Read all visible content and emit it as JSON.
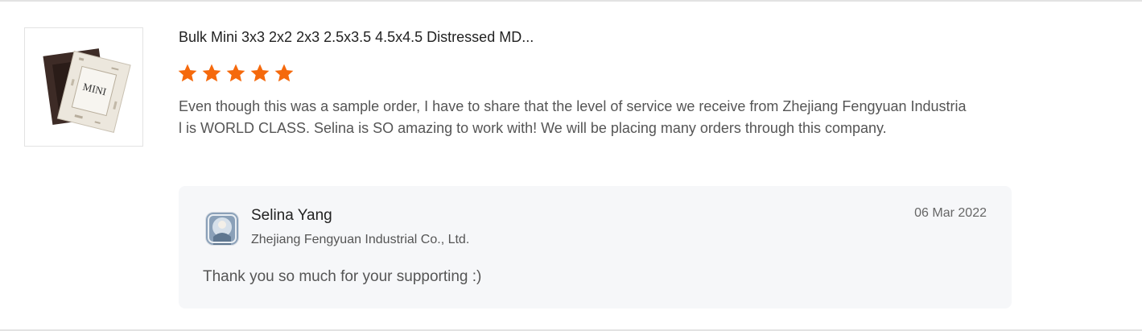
{
  "review": {
    "product_title": "Bulk Mini 3x3 2x2 2x3 2.5x3.5 4.5x4.5 Distressed MD...",
    "rating": 5,
    "rating_max": 5,
    "star_color": "#f5690c",
    "text": "Even though this was a sample order, I have to share that the level of service we receive from Zhejiang Fengyuan Industrial is WORLD CLASS.  Selina is SO amazing to work with!  We will be placing many orders through this company.",
    "thumbnail_label": "MINI",
    "thumbnail_icon": "photo-frame-icon"
  },
  "reply": {
    "name": "Selina Yang",
    "company": "Zhejiang Fengyuan Industrial Co., Ltd.",
    "date": "06 Mar 2022",
    "text": "Thank you so much for your supporting :)",
    "avatar_icon": "avatar-icon",
    "background": "#f6f7f9"
  }
}
